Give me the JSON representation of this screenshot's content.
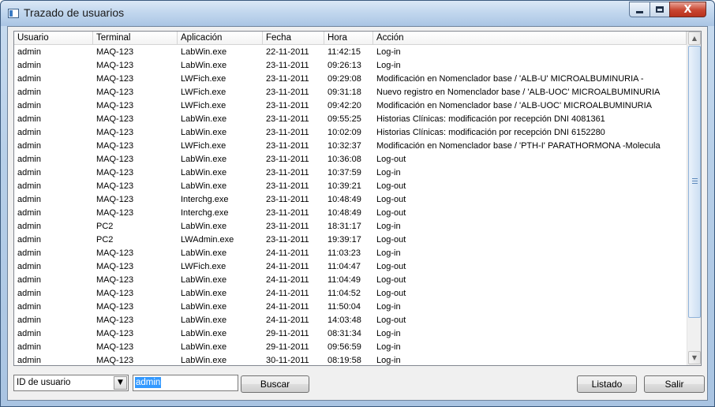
{
  "window": {
    "title": "Trazado de usuarios",
    "close_glyph": "X"
  },
  "columns": [
    "Usuario",
    "Terminal",
    "Aplicación",
    "Fecha",
    "Hora",
    "Acción"
  ],
  "rows": [
    [
      "admin",
      "MAQ-123",
      "LabWin.exe",
      "22-11-2011",
      "11:42:15",
      "Log-in"
    ],
    [
      "admin",
      "MAQ-123",
      "LabWin.exe",
      "23-11-2011",
      "09:26:13",
      "Log-in"
    ],
    [
      "admin",
      "MAQ-123",
      "LWFich.exe",
      "23-11-2011",
      "09:29:08",
      "Modificación en Nomenclador base / 'ALB-U' MICROALBUMINURIA -"
    ],
    [
      "admin",
      "MAQ-123",
      "LWFich.exe",
      "23-11-2011",
      "09:31:18",
      "Nuevo registro en Nomenclador base / 'ALB-UOC' MICROALBUMINURIA"
    ],
    [
      "admin",
      "MAQ-123",
      "LWFich.exe",
      "23-11-2011",
      "09:42:20",
      "Modificación en Nomenclador base / 'ALB-UOC' MICROALBUMINURIA"
    ],
    [
      "admin",
      "MAQ-123",
      "LabWin.exe",
      "23-11-2011",
      "09:55:25",
      "Historias Clínicas: modificación por recepción DNI 4081361"
    ],
    [
      "admin",
      "MAQ-123",
      "LabWin.exe",
      "23-11-2011",
      "10:02:09",
      "Historias Clínicas: modificación por recepción DNI 6152280"
    ],
    [
      "admin",
      "MAQ-123",
      "LWFich.exe",
      "23-11-2011",
      "10:32:37",
      "Modificación en Nomenclador base / 'PTH-I' PARATHORMONA -Molecula"
    ],
    [
      "admin",
      "MAQ-123",
      "LabWin.exe",
      "23-11-2011",
      "10:36:08",
      "Log-out"
    ],
    [
      "admin",
      "MAQ-123",
      "LabWin.exe",
      "23-11-2011",
      "10:37:59",
      "Log-in"
    ],
    [
      "admin",
      "MAQ-123",
      "LabWin.exe",
      "23-11-2011",
      "10:39:21",
      "Log-out"
    ],
    [
      "admin",
      "MAQ-123",
      "Interchg.exe",
      "23-11-2011",
      "10:48:49",
      "Log-out"
    ],
    [
      "admin",
      "MAQ-123",
      "Interchg.exe",
      "23-11-2011",
      "10:48:49",
      "Log-out"
    ],
    [
      "admin",
      "PC2",
      "LabWin.exe",
      "23-11-2011",
      "18:31:17",
      "Log-in"
    ],
    [
      "admin",
      "PC2",
      "LWAdmin.exe",
      "23-11-2011",
      "19:39:17",
      "Log-out"
    ],
    [
      "admin",
      "MAQ-123",
      "LabWin.exe",
      "24-11-2011",
      "11:03:23",
      "Log-in"
    ],
    [
      "admin",
      "MAQ-123",
      "LWFich.exe",
      "24-11-2011",
      "11:04:47",
      "Log-out"
    ],
    [
      "admin",
      "MAQ-123",
      "LabWin.exe",
      "24-11-2011",
      "11:04:49",
      "Log-out"
    ],
    [
      "admin",
      "MAQ-123",
      "LabWin.exe",
      "24-11-2011",
      "11:04:52",
      "Log-out"
    ],
    [
      "admin",
      "MAQ-123",
      "LabWin.exe",
      "24-11-2011",
      "11:50:04",
      "Log-in"
    ],
    [
      "admin",
      "MAQ-123",
      "LabWin.exe",
      "24-11-2011",
      "14:03:48",
      "Log-out"
    ],
    [
      "admin",
      "MAQ-123",
      "LabWin.exe",
      "29-11-2011",
      "08:31:34",
      "Log-in"
    ],
    [
      "admin",
      "MAQ-123",
      "LabWin.exe",
      "29-11-2011",
      "09:56:59",
      "Log-in"
    ],
    [
      "admin",
      "MAQ-123",
      "LabWin.exe",
      "30-11-2011",
      "08:19:58",
      "Log-in"
    ]
  ],
  "filter": {
    "field_selected": "ID de usuario",
    "search_value": "admin",
    "search_label": "Buscar"
  },
  "actions": {
    "listado_label": "Listado",
    "salir_label": "Salir"
  }
}
